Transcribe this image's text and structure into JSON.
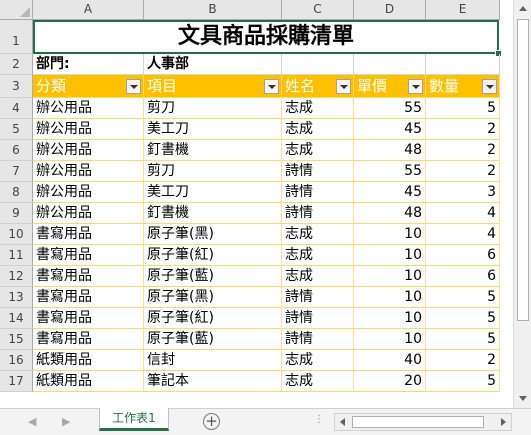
{
  "columns": [
    "A",
    "B",
    "C",
    "D",
    "E"
  ],
  "row_numbers": [
    "1",
    "2",
    "3",
    "4",
    "5",
    "6",
    "7",
    "8",
    "9",
    "10",
    "11",
    "12",
    "13",
    "14",
    "15",
    "16",
    "17"
  ],
  "title": "文具商品採購清單",
  "dept_label": "部門:",
  "dept_value": "人事部",
  "headers": [
    "分類",
    "項目",
    "姓名",
    "單價",
    "數量"
  ],
  "rows": [
    [
      "辦公用品",
      "剪刀",
      "志成",
      "55",
      "5"
    ],
    [
      "辦公用品",
      "美工刀",
      "志成",
      "45",
      "2"
    ],
    [
      "辦公用品",
      "釘書機",
      "志成",
      "48",
      "2"
    ],
    [
      "辦公用品",
      "剪刀",
      "詩情",
      "55",
      "2"
    ],
    [
      "辦公用品",
      "美工刀",
      "詩情",
      "45",
      "3"
    ],
    [
      "辦公用品",
      "釘書機",
      "詩情",
      "48",
      "4"
    ],
    [
      "書寫用品",
      "原子筆(黑)",
      "志成",
      "10",
      "4"
    ],
    [
      "書寫用品",
      "原子筆(紅)",
      "志成",
      "10",
      "6"
    ],
    [
      "書寫用品",
      "原子筆(藍)",
      "志成",
      "10",
      "6"
    ],
    [
      "書寫用品",
      "原子筆(黑)",
      "詩情",
      "10",
      "5"
    ],
    [
      "書寫用品",
      "原子筆(紅)",
      "詩情",
      "10",
      "5"
    ],
    [
      "書寫用品",
      "原子筆(藍)",
      "詩情",
      "10",
      "5"
    ],
    [
      "紙類用品",
      "信封",
      "志成",
      "40",
      "2"
    ],
    [
      "紙類用品",
      "筆記本",
      "志成",
      "20",
      "5"
    ]
  ],
  "sheet_tab": "工作表1",
  "colors": {
    "header_fill": "#FFC000",
    "header_text": "#FFFFFF",
    "row_border": "#FFD966",
    "active_tab": "#217346"
  }
}
